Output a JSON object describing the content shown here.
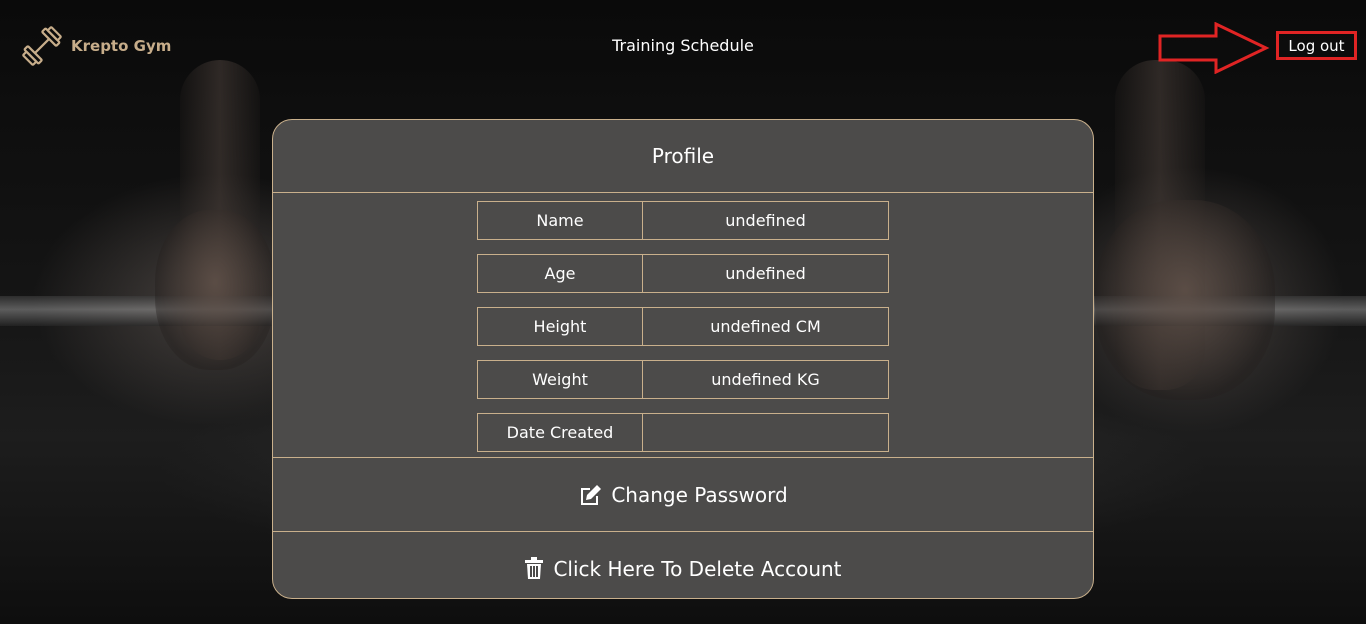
{
  "header": {
    "brand": "Krepto Gym",
    "nav_link": "Training Schedule",
    "logout_label": "Log out"
  },
  "profile": {
    "title": "Profile",
    "rows": [
      {
        "label": "Name",
        "value": "undefined"
      },
      {
        "label": "Age",
        "value": "undefined"
      },
      {
        "label": "Height",
        "value": "undefined CM"
      },
      {
        "label": "Weight",
        "value": "undefined KG"
      },
      {
        "label": "Date Created",
        "value": ""
      }
    ],
    "change_password_label": "Change Password",
    "delete_account_label": "Click Here To Delete Account"
  },
  "icons": {
    "logo": "dumbbell-icon",
    "change_password": "edit-icon",
    "delete_account": "trash-icon",
    "annotation": "arrow-right-icon"
  },
  "colors": {
    "accent": "#c9b08c",
    "brand_text": "#c7ad8a",
    "card_bg": "#4c4b4a",
    "highlight": "#e02424"
  }
}
